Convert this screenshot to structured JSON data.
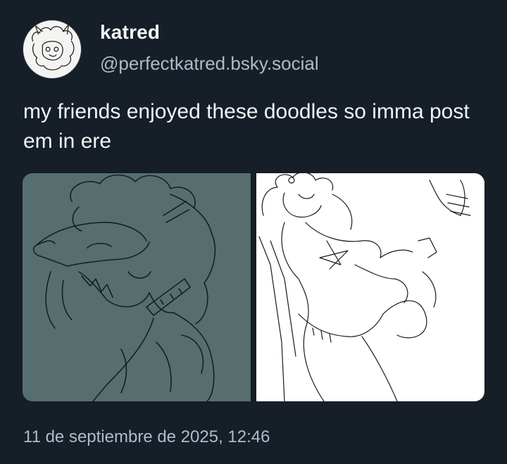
{
  "author": {
    "display_name": "katred",
    "handle": "@perfectkatred.bsky.social",
    "avatar_icon": "avatar-sketch"
  },
  "post": {
    "text": "my friends enjoyed these doodles so imma post em in ere",
    "timestamp": "11 de septiembre de 2025, 12:46",
    "images": [
      {
        "icon": "teal-sketch-doodle",
        "background": "#566f6e"
      },
      {
        "icon": "pencil-sketch-doodle",
        "background": "#ffffff"
      }
    ]
  },
  "colors": {
    "background": "#161e27",
    "primary_text": "#f1f3f5",
    "secondary_text": "#aebbc9"
  }
}
